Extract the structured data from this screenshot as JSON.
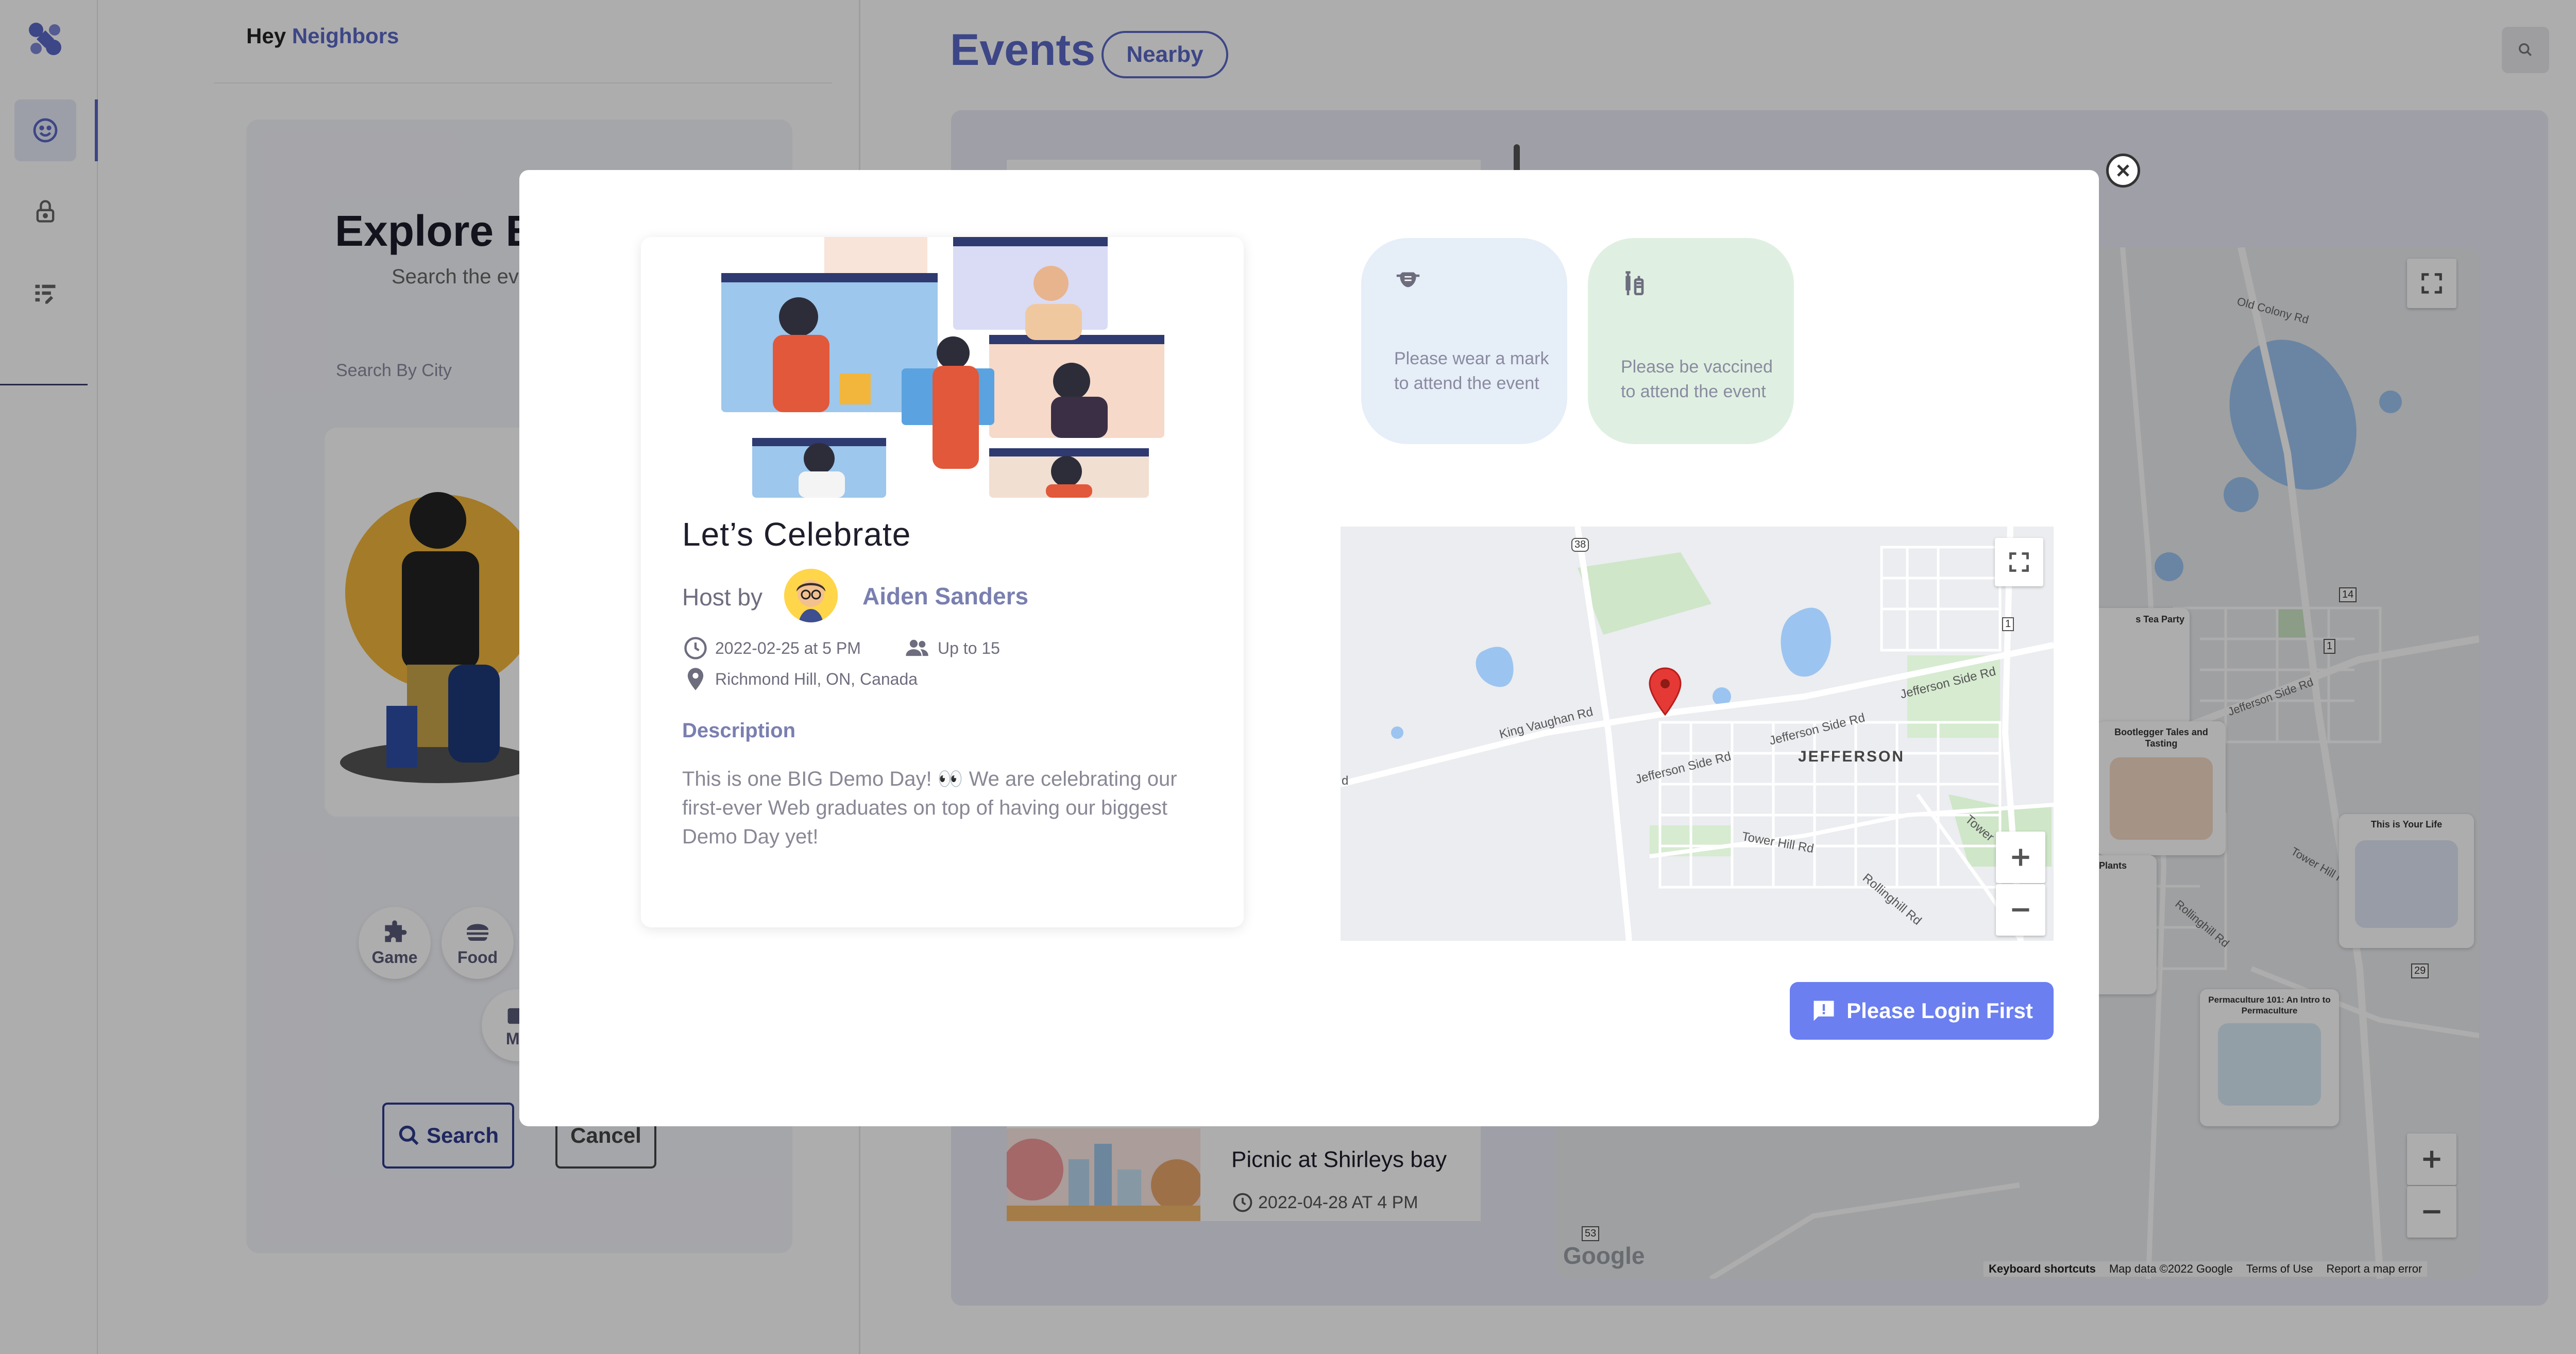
{
  "nav": {
    "items": [
      {
        "icon": "smile-icon",
        "active": true
      },
      {
        "icon": "lock-icon",
        "active": false
      },
      {
        "icon": "dashboard-icon",
        "active": false
      }
    ]
  },
  "header": {
    "hey": "Hey",
    "brand": "Neighbors"
  },
  "explore": {
    "title": "Explore Ex",
    "subtitle": "Search the ev",
    "search_city_placeholder": "Search By City",
    "categories": [
      {
        "label": "Game",
        "icon": "puzzle-icon"
      },
      {
        "label": "Food",
        "icon": "food-icon"
      },
      {
        "label": "Mo",
        "icon": "movie-icon"
      }
    ],
    "search_label": "Search",
    "cancel_label": "Cancel"
  },
  "events": {
    "title": "Events",
    "filter_label": "Nearby",
    "list": [
      {
        "title": "Picnic at Shirleys bay",
        "date": "2022-04-28 AT 4 PM"
      }
    ],
    "map": {
      "place_labels": [
        "Old Colony Rd",
        "Jefferson Side Rd",
        "Tower Hill Rd",
        "Rollinghill Rd"
      ],
      "route_shields": [
        "14",
        "1",
        "29",
        "53"
      ],
      "markers": [
        {
          "title": "s Tea Party"
        },
        {
          "title": "Bootlegger Tales and Tasting"
        },
        {
          "title": "This is Your Life"
        },
        {
          "title": "Plants"
        },
        {
          "title": "Permaculture 101: An Intro to Permaculture"
        }
      ],
      "attribution": {
        "logo": "Google",
        "keyboard": "Keyboard shortcuts",
        "data": "Map data ©2022 Google",
        "terms": "Terms of Use",
        "report": "Report a map error"
      }
    }
  },
  "modal": {
    "event": {
      "title": "Let’s Celebrate",
      "host_label": "Host by",
      "host_name": "Aiden Sanders",
      "datetime": "2022-02-25 at 5 PM",
      "capacity": "Up to 15",
      "location": "Richmond Hill, ON, Canada",
      "description_heading": "Description",
      "description": "This is one BIG Demo Day! 👀 We are celebrating our first-ever Web graduates on top of having our biggest Demo Day yet!"
    },
    "rules": [
      {
        "icon": "mask-icon",
        "line1": "Please wear a mark",
        "line2": "to attend the event",
        "color": "#e6eef8"
      },
      {
        "icon": "vaccine-icon",
        "line1": "Please be vaccined",
        "line2": "to attend the event",
        "color": "#dff0e2"
      }
    ],
    "map": {
      "labels": [
        "King Vaughan Rd",
        "Jefferson Side Rd",
        "Jefferson Side Rd",
        "Jefferson Side Rd",
        "JEFFERSON",
        "Tower Hill Rd",
        "Tower",
        "Rollinghill Rd",
        "d"
      ],
      "shields": [
        "38",
        "1"
      ]
    },
    "login_label": "Please Login First"
  },
  "colors": {
    "accent": "#5a68c6",
    "login_button": "#6b7ff0"
  }
}
